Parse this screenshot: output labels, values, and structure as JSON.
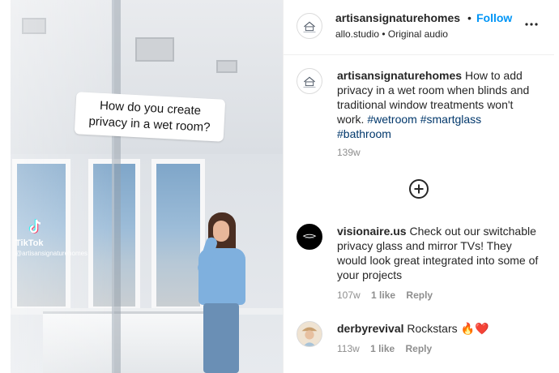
{
  "media": {
    "overlay_text": "How do you create privacy in a wet room?",
    "watermark_brand": "TikTok",
    "watermark_handle": "@artisansignaturehomes"
  },
  "header": {
    "username": "artisansignaturehomes",
    "separator": "•",
    "follow_label": "Follow",
    "audio_source": "allo.studio • Original audio",
    "more_icon": "more-horizontal-icon"
  },
  "post": {
    "username": "artisansignaturehomes",
    "text": "How to add privacy in a wet room when blinds and traditional window treatments won't work.",
    "hashtags": [
      "#wetroom",
      "#smartglass",
      "#bathroom"
    ],
    "time": "139w"
  },
  "load_more_icon": "circle-plus-icon",
  "comments": [
    {
      "username": "visionaire.us",
      "text": "Check out our switchable privacy glass and mirror TVs! They would look great integrated into some of your projects",
      "time": "107w",
      "likes": "1 like",
      "reply_label": "Reply"
    },
    {
      "username": "derbyrevival",
      "text": "Rockstars",
      "emoji": "🔥❤️",
      "time": "113w",
      "likes": "1 like",
      "reply_label": "Reply"
    }
  ],
  "colors": {
    "link_blue": "#0095f6",
    "hashtag": "#00376b",
    "muted": "#8e8e8e",
    "text": "#262626"
  }
}
